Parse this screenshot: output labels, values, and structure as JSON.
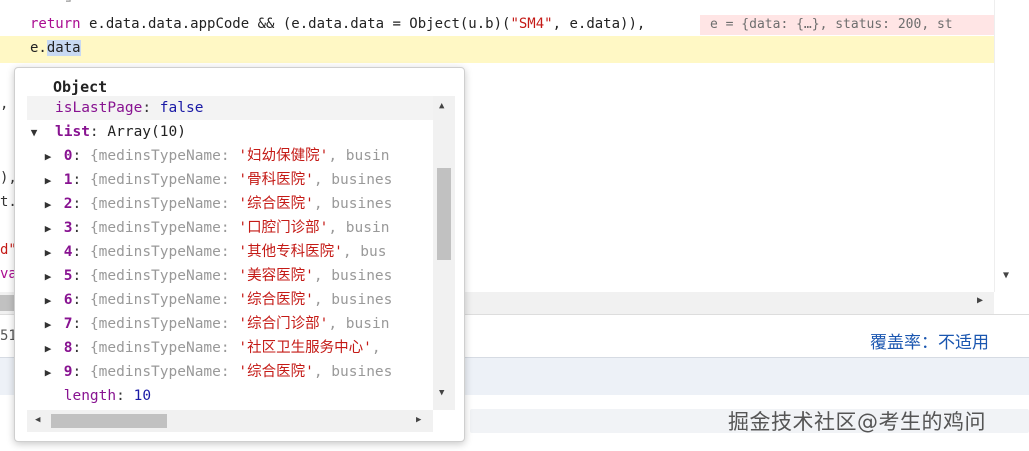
{
  "editor": {
    "line_return": {
      "kw": "return",
      "code1": " e.data.data.appCode && (e.data.data = Object(u.b)(",
      "str": "\"SM4\"",
      "code2": ", e.data)),"
    },
    "inline_value": "e = {data: {…}, status: 200, st",
    "current_line": {
      "prefix": "e.",
      "selected": "data"
    },
    "edge_fragments": [
      ",",
      "),",
      "t.a",
      "d\"",
      "var"
    ]
  },
  "popover": {
    "title": "Object",
    "is_last_page": {
      "key": "isLastPage",
      "value": "false"
    },
    "list": {
      "key": "list",
      "value": "Array(10)"
    },
    "items": [
      {
        "index": "0",
        "prefix": "{medinsTypeName: ",
        "name": "'妇幼保健院'",
        "suffix": ", busin"
      },
      {
        "index": "1",
        "prefix": "{medinsTypeName: ",
        "name": "'骨科医院'",
        "suffix": ", busines"
      },
      {
        "index": "2",
        "prefix": "{medinsTypeName: ",
        "name": "'综合医院'",
        "suffix": ", busines"
      },
      {
        "index": "3",
        "prefix": "{medinsTypeName: ",
        "name": "'口腔门诊部'",
        "suffix": ", busin"
      },
      {
        "index": "4",
        "prefix": "{medinsTypeName: ",
        "name": "'其他专科医院'",
        "suffix": ", bus"
      },
      {
        "index": "5",
        "prefix": "{medinsTypeName: ",
        "name": "'美容医院'",
        "suffix": ", busines"
      },
      {
        "index": "6",
        "prefix": "{medinsTypeName: ",
        "name": "'综合医院'",
        "suffix": ", busines"
      },
      {
        "index": "7",
        "prefix": "{medinsTypeName: ",
        "name": "'综合门诊部'",
        "suffix": ", busin"
      },
      {
        "index": "8",
        "prefix": "{medinsTypeName: ",
        "name": "'社区卫生服务中心'",
        "suffix": ","
      },
      {
        "index": "9",
        "prefix": "{medinsTypeName: ",
        "name": "'综合医院'",
        "suffix": ", busines"
      }
    ],
    "length": {
      "key": "length",
      "value": "10"
    }
  },
  "status": {
    "coverage": "覆盖率：不适用",
    "left_fragment": "51"
  },
  "watermark": "掘金技术社区@考生的鸡问",
  "colors": {
    "key": "#881391",
    "string": "#c41a16",
    "boolean": "#1a1aa6",
    "highlight_line": "#fff8c5",
    "inline_value_bg": "#ffe5e5",
    "coverage_link": "#1a56b0"
  },
  "icons": {
    "expand": "triangle-right-icon",
    "collapse": "triangle-down-icon"
  }
}
